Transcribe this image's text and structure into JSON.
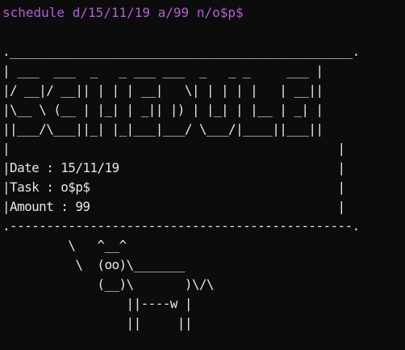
{
  "terminal": {
    "command": "schedule d/15/11/19 a/99 n/o$p$",
    "colors": {
      "background": "#0c0c0c",
      "command_text": "#b65bd8",
      "output_text": "#e6e6e6"
    },
    "output_lines": [
      "._______________________________________________.",
      "| ___  ___  _   _ ___ ___  _   _ _     ___ |",
      "|/ __|/ __|| | | | __|   \\| | | | |   | __||",
      "|\\__ \\ (__ | |_| | _|| |) | |_| | |__ | _| |",
      "||___/\\___||_| |_|___|___/ \\___/|____||___||",
      "|                                             |",
      "|Date : 15/11/19                              |",
      "|Task : o$p$                                  |",
      "|Amount : 99                                  |",
      ".-----------------------------------------------.",
      "         \\   ^__^",
      "          \\  (oo)\\_______",
      "             (__)\\       )\\/\\",
      "                 ||----w |",
      "                 ||     ||"
    ]
  }
}
